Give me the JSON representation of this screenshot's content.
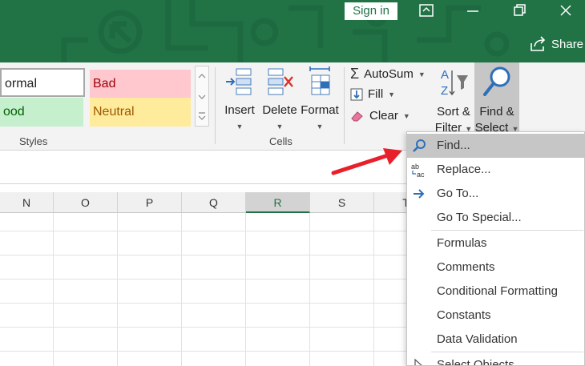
{
  "titlebar": {
    "signin_label": "Sign in",
    "share_label": "Share",
    "accent": "#217346"
  },
  "ribbon": {
    "styles": {
      "normal_label": "ormal",
      "bad_label": "Bad",
      "good_label": "ood",
      "neutral_label": "Neutral",
      "group_label": "Styles"
    },
    "cells": {
      "insert_label": "Insert",
      "delete_label": "Delete",
      "format_label": "Format",
      "group_label": "Cells"
    },
    "editing": {
      "autosum_label": "AutoSum",
      "fill_label": "Fill",
      "clear_label": "Clear",
      "sort_line1": "Sort &",
      "sort_line2": "Filter",
      "find_line1": "Find &",
      "find_line2": "Select"
    }
  },
  "sheet": {
    "columns": [
      "N",
      "O",
      "P",
      "Q",
      "R",
      "S",
      "T"
    ],
    "selected_column": "R"
  },
  "menu": {
    "items": [
      {
        "label": "Find...",
        "icon": "search-icon"
      },
      {
        "label": "Replace...",
        "icon": "replace-icon"
      },
      {
        "label": "Go To...",
        "icon": "arrow-right-icon"
      },
      {
        "label": "Go To Special...",
        "icon": ""
      },
      {
        "label": "Formulas",
        "icon": ""
      },
      {
        "label": "Comments",
        "icon": ""
      },
      {
        "label": "Conditional Formatting",
        "icon": ""
      },
      {
        "label": "Constants",
        "icon": ""
      },
      {
        "label": "Data Validation",
        "icon": ""
      },
      {
        "label": "Select Objects",
        "icon": "pointer-icon"
      }
    ]
  },
  "annotation": {
    "arrow_color": "#e8202a"
  }
}
